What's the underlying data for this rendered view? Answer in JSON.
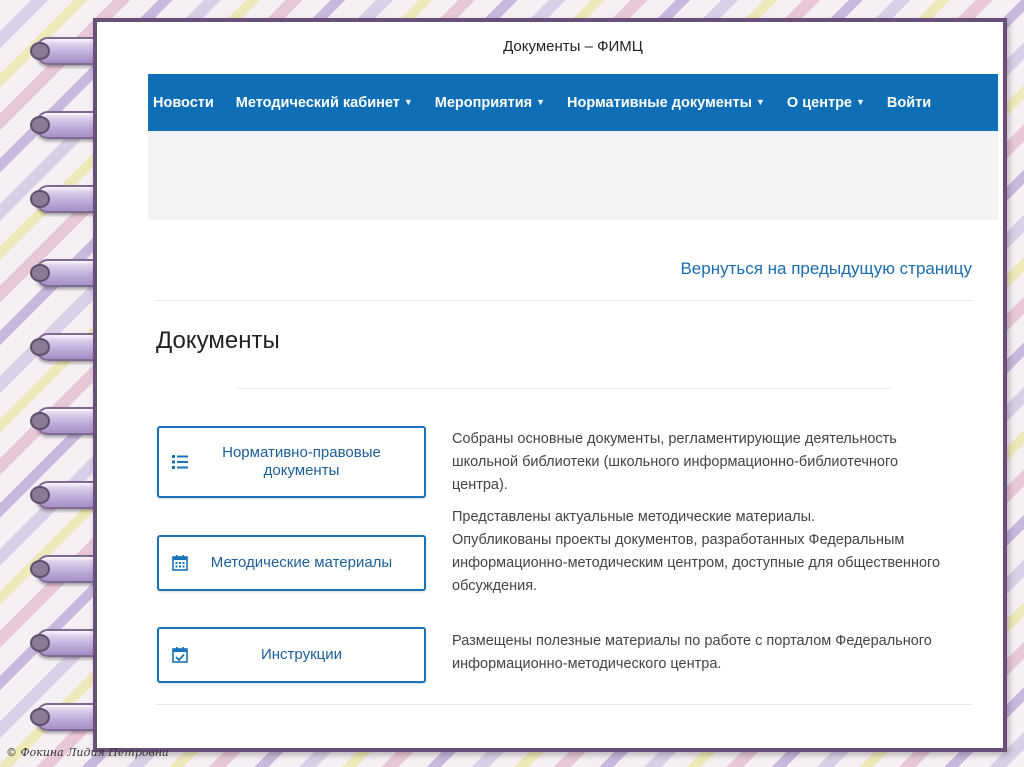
{
  "site_title": "Документы – ФИМЦ",
  "nav": {
    "items": [
      {
        "label": "Новости",
        "dropdown": false
      },
      {
        "label": "Методический кабинет",
        "dropdown": true
      },
      {
        "label": "Мероприятия",
        "dropdown": true
      },
      {
        "label": "Нормативные документы",
        "dropdown": true
      },
      {
        "label": "О центре",
        "dropdown": true
      },
      {
        "label": "Войти",
        "dropdown": false
      }
    ],
    "caret": "▼",
    "color": "#0e6fb6"
  },
  "back_link": "Вернуться на предыдущую страницу",
  "page_title": "Документы",
  "cards": [
    {
      "icon": "list-icon",
      "label": "Нормативно-правовые документы"
    },
    {
      "icon": "calendar-icon",
      "label": "Методические материалы"
    },
    {
      "icon": "calendar-check-icon",
      "label": "Инструкции"
    }
  ],
  "descriptions": [
    "Собраны основные документы, регламентирующие деятельность школьной библиотеки (школьного информационно-библиотечного центра).",
    "Представлены актуальные методические материалы.",
    "Опубликованы проекты документов, разработанных Федеральным информационно-методическим центром, доступные для общественного обсуждения.",
    "Размещены полезные материалы по работе с порталом Федерального информационно-методического центра."
  ],
  "signature": "© Фокина Лидия Петровна",
  "accent_color": "#1a72b8"
}
